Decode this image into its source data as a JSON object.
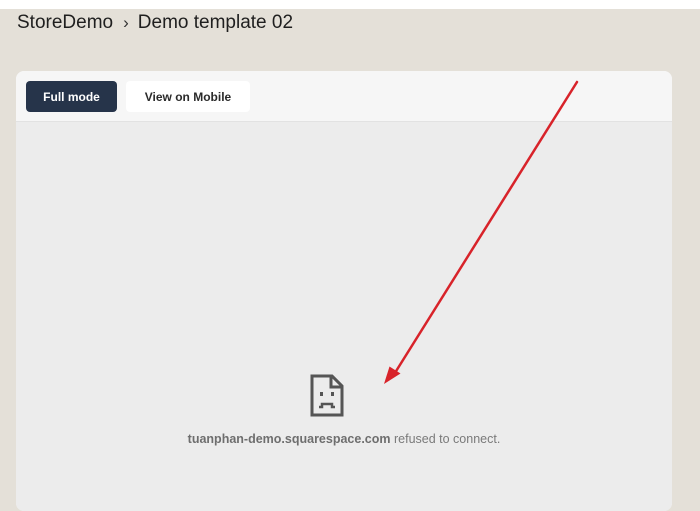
{
  "breadcrumb": {
    "store": "StoreDemo",
    "separator": "›",
    "page": "Demo template 02"
  },
  "toolbar": {
    "full_mode_label": "Full mode",
    "mobile_label": "View on Mobile"
  },
  "preview": {
    "icon": "sad-document-icon",
    "host": "tuanphan-demo.squarespace.com",
    "message": "refused to connect."
  },
  "annotation": {
    "icon": "arrow-icon",
    "color": "#d8232a"
  },
  "colors": {
    "background": "#e4e0d8",
    "primary_button": "#26344a",
    "frame": "#ececec"
  }
}
